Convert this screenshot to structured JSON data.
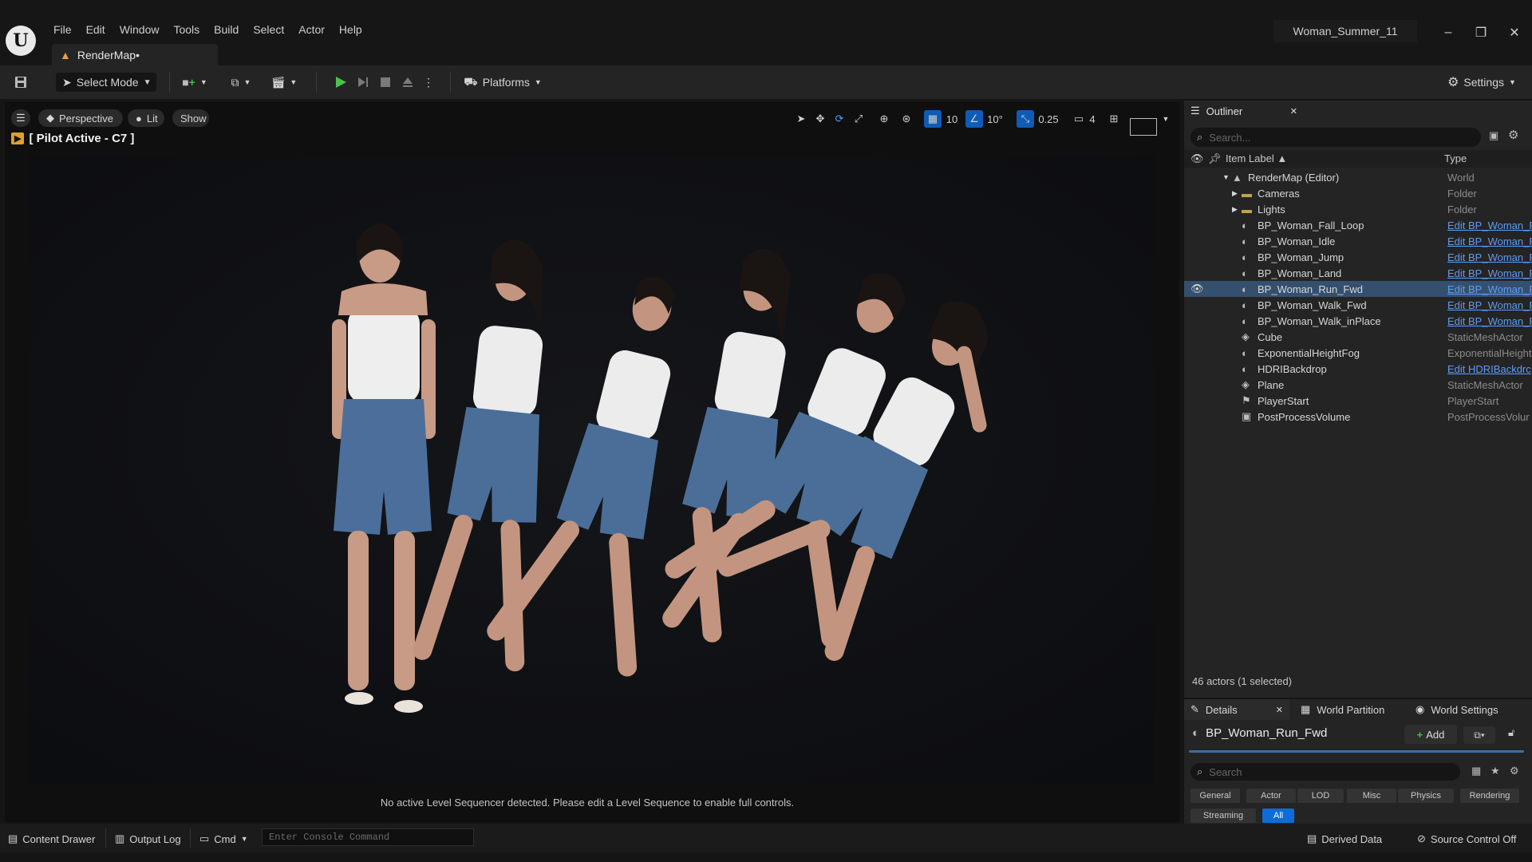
{
  "menu": [
    "File",
    "Edit",
    "Window",
    "Tools",
    "Build",
    "Select",
    "Actor",
    "Help"
  ],
  "doc_tab": "RenderMap•",
  "project_name": "Woman_Summer_11",
  "toolbar": {
    "select_mode": "Select Mode",
    "platforms": "Platforms",
    "settings": "Settings"
  },
  "viewport": {
    "perspective": "Perspective",
    "lit": "Lit",
    "show": "Show",
    "pilot": "[ Pilot Active - C7 ]",
    "grid_snap": "10",
    "rot_snap": "10°",
    "scale_snap": "0.25",
    "camera_speed": "4",
    "message": "No active Level Sequencer detected. Please edit a Level Sequence to enable full controls."
  },
  "outliner": {
    "tab": "Outliner",
    "search_placeholder": "Search...",
    "col_label": "Item Label ▲",
    "col_type": "Type",
    "rows": [
      {
        "label": "RenderMap (Editor)",
        "type": "World",
        "link": false,
        "indent": 0,
        "icon": "world"
      },
      {
        "label": "Cameras",
        "type": "Folder",
        "link": false,
        "indent": 1,
        "icon": "folder"
      },
      {
        "label": "Lights",
        "type": "Folder",
        "link": false,
        "indent": 1,
        "icon": "folder"
      },
      {
        "label": "BP_Woman_Fall_Loop",
        "type": "Edit BP_Woman_F",
        "link": true,
        "indent": 1,
        "icon": "actor"
      },
      {
        "label": "BP_Woman_Idle",
        "type": "Edit BP_Woman_F",
        "link": true,
        "indent": 1,
        "icon": "actor"
      },
      {
        "label": "BP_Woman_Jump",
        "type": "Edit BP_Woman_F",
        "link": true,
        "indent": 1,
        "icon": "actor"
      },
      {
        "label": "BP_Woman_Land",
        "type": "Edit BP_Woman_F",
        "link": true,
        "indent": 1,
        "icon": "actor"
      },
      {
        "label": "BP_Woman_Run_Fwd",
        "type": "Edit BP_Woman_F",
        "link": true,
        "indent": 1,
        "icon": "actor"
      },
      {
        "label": "BP_Woman_Walk_Fwd",
        "type": "Edit BP_Woman_F",
        "link": true,
        "indent": 1,
        "icon": "actor"
      },
      {
        "label": "BP_Woman_Walk_inPlace",
        "type": "Edit BP_Woman_F",
        "link": true,
        "indent": 1,
        "icon": "actor"
      },
      {
        "label": "Cube",
        "type": "StaticMeshActor",
        "link": false,
        "indent": 1,
        "icon": "mesh"
      },
      {
        "label": "ExponentialHeightFog",
        "type": "ExponentialHeight",
        "link": false,
        "indent": 1,
        "icon": "actor"
      },
      {
        "label": "HDRIBackdrop",
        "type": "Edit HDRIBackdrc",
        "link": true,
        "indent": 1,
        "icon": "actor"
      },
      {
        "label": "Plane",
        "type": "StaticMeshActor",
        "link": false,
        "indent": 1,
        "icon": "mesh"
      },
      {
        "label": "PlayerStart",
        "type": "PlayerStart",
        "link": false,
        "indent": 1,
        "icon": "flag"
      },
      {
        "label": "PostProcessVolume",
        "type": "PostProcessVolur",
        "link": false,
        "indent": 1,
        "icon": "volume"
      }
    ],
    "selected_index": 7,
    "actor_count": "46 actors (1 selected)"
  },
  "details": {
    "tab": "Details",
    "tab_partition": "World Partition",
    "tab_settings": "World Settings",
    "title": "BP_Woman_Run_Fwd",
    "add": "Add",
    "search_placeholder": "Search",
    "filters": [
      "General",
      "Actor",
      "LOD",
      "Misc",
      "Physics",
      "Rendering",
      "Streaming",
      "All"
    ]
  },
  "statusbar": {
    "content_drawer": "Content Drawer",
    "output_log": "Output Log",
    "cmd": "Cmd",
    "console_placeholder": "Enter Console Command",
    "derived_data": "Derived Data",
    "source_control": "Source Control Off"
  }
}
